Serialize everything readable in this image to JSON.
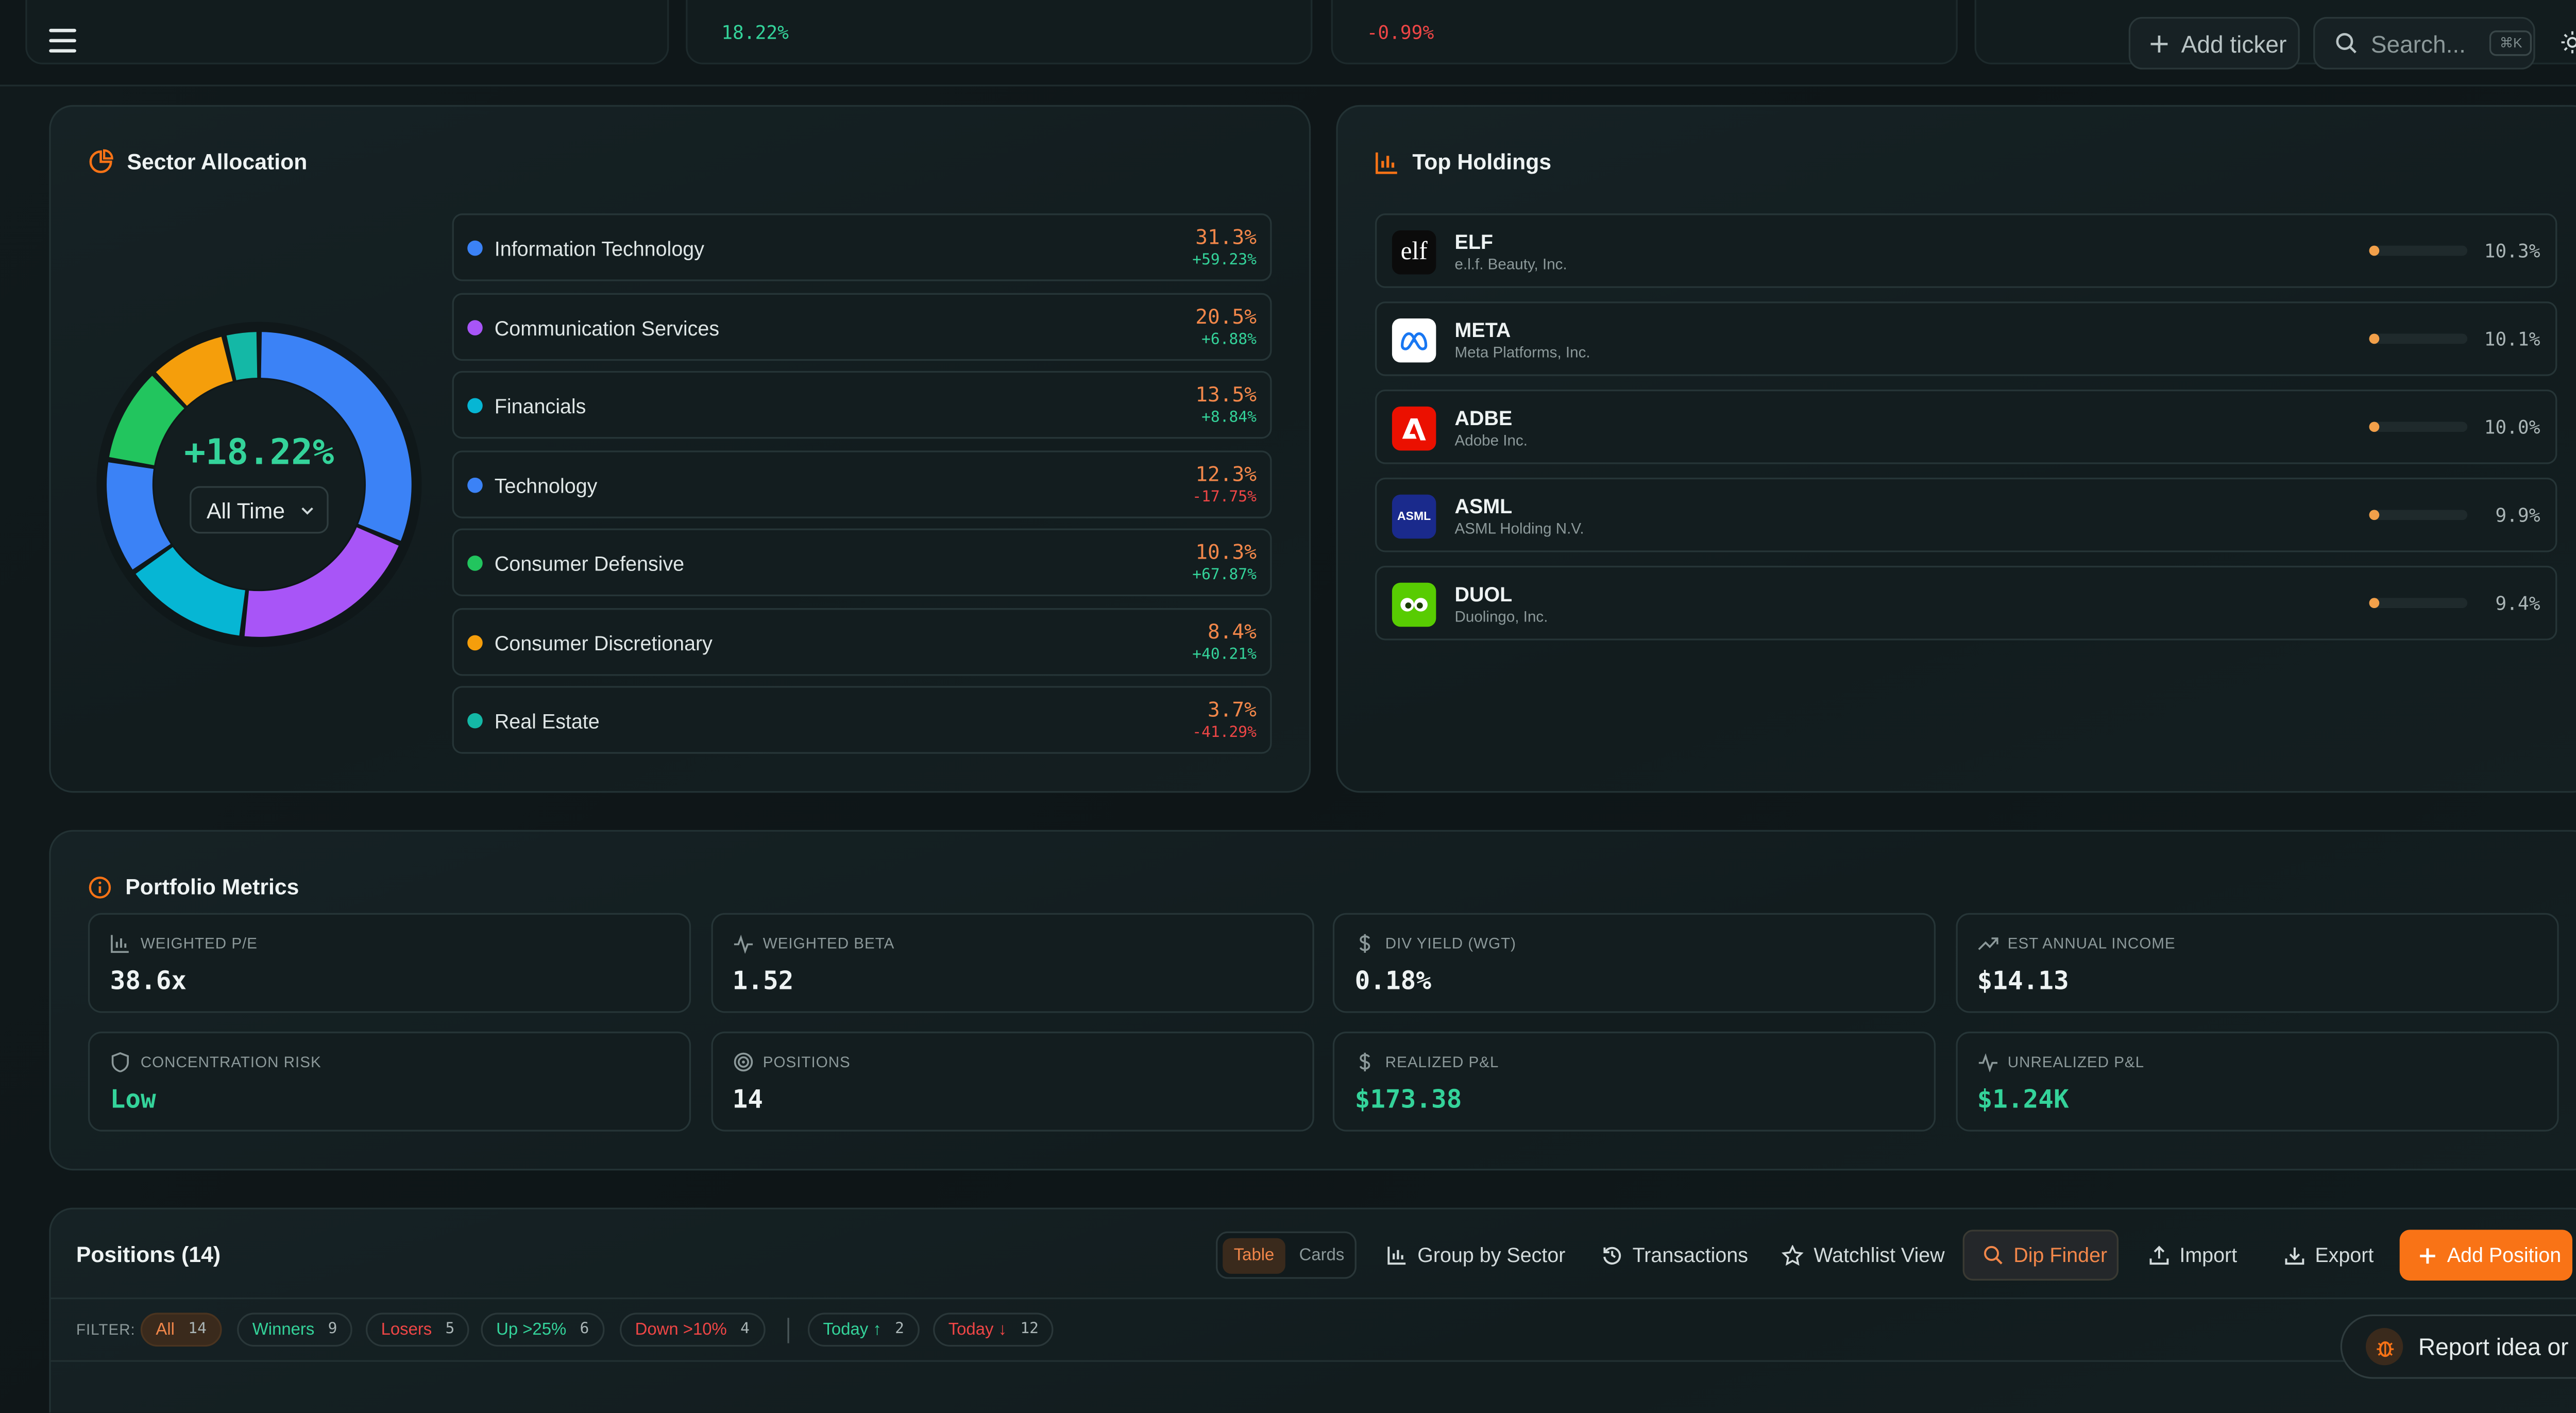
{
  "header": {
    "ghost_values": [
      "18.22%",
      "-0.99%"
    ],
    "add_ticker_label": "Add ticker",
    "search_placeholder": "Search...",
    "search_shortcut": "⌘K"
  },
  "sector_allocation": {
    "title": "Sector Allocation",
    "donut_value": "+18.22%",
    "period_select": "All Time",
    "sectors": [
      {
        "name": "Information Technology",
        "weight": "31.3%",
        "change": "+59.23%",
        "color": "#3b82f6",
        "positive": true
      },
      {
        "name": "Communication Services",
        "weight": "20.5%",
        "change": "+6.88%",
        "color": "#a855f7",
        "positive": true
      },
      {
        "name": "Financials",
        "weight": "13.5%",
        "change": "+8.84%",
        "color": "#06b6d4",
        "positive": true
      },
      {
        "name": "Technology",
        "weight": "12.3%",
        "change": "-17.75%",
        "color": "#3b82f6",
        "positive": false
      },
      {
        "name": "Consumer Defensive",
        "weight": "10.3%",
        "change": "+67.87%",
        "color": "#22c55e",
        "positive": true
      },
      {
        "name": "Consumer Discretionary",
        "weight": "8.4%",
        "change": "+40.21%",
        "color": "#f59e0b",
        "positive": true
      },
      {
        "name": "Real Estate",
        "weight": "3.7%",
        "change": "-41.29%",
        "color": "#14b8a6",
        "positive": false
      }
    ]
  },
  "top_holdings": {
    "title": "Top Holdings",
    "items": [
      {
        "ticker": "ELF",
        "company": "e.l.f. Beauty, Inc.",
        "weight": "10.3%",
        "fraction": 0.103
      },
      {
        "ticker": "META",
        "company": "Meta Platforms, Inc.",
        "weight": "10.1%",
        "fraction": 0.101
      },
      {
        "ticker": "ADBE",
        "company": "Adobe Inc.",
        "weight": "10.0%",
        "fraction": 0.1
      },
      {
        "ticker": "ASML",
        "company": "ASML Holding N.V.",
        "weight": "9.9%",
        "fraction": 0.099
      },
      {
        "ticker": "DUOL",
        "company": "Duolingo, Inc.",
        "weight": "9.4%",
        "fraction": 0.094
      }
    ],
    "logos": {
      "elf": "elf",
      "asml": "ASML"
    }
  },
  "metrics": {
    "title": "Portfolio Metrics",
    "items": [
      {
        "label": "WEIGHTED P/E",
        "value": "38.6x"
      },
      {
        "label": "WEIGHTED BETA",
        "value": "1.52"
      },
      {
        "label": "DIV YIELD (WGT)",
        "value": "0.18%"
      },
      {
        "label": "EST ANNUAL INCOME",
        "value": "$14.13"
      },
      {
        "label": "CONCENTRATION RISK",
        "value": "Low"
      },
      {
        "label": "POSITIONS",
        "value": "14"
      },
      {
        "label": "REALIZED P&L",
        "value": "$173.38"
      },
      {
        "label": "UNREALIZED P&L",
        "value": "$1.24K"
      }
    ]
  },
  "positions": {
    "title": "Positions (14)",
    "view_table": "Table",
    "view_cards": "Cards",
    "group_by_sector": "Group by Sector",
    "transactions": "Transactions",
    "watchlist_view": "Watchlist View",
    "dip_finder": "Dip Finder",
    "import": "Import",
    "export": "Export",
    "add_position": "Add Position",
    "filter_label": "FILTER:",
    "filters": [
      {
        "label": "All",
        "count": "14"
      },
      {
        "label": "Winners",
        "count": "9"
      },
      {
        "label": "Losers",
        "count": "5"
      },
      {
        "label": "Up >25%",
        "count": "6"
      },
      {
        "label": "Down >10%",
        "count": "4"
      },
      {
        "label": "Today ↑",
        "count": "2"
      },
      {
        "label": "Today ↓",
        "count": "12"
      }
    ]
  },
  "feedback": {
    "label": "Report idea or bug"
  },
  "colors": {
    "accent": "#f97316",
    "positive": "#34d39a",
    "negative": "#ef4646"
  }
}
